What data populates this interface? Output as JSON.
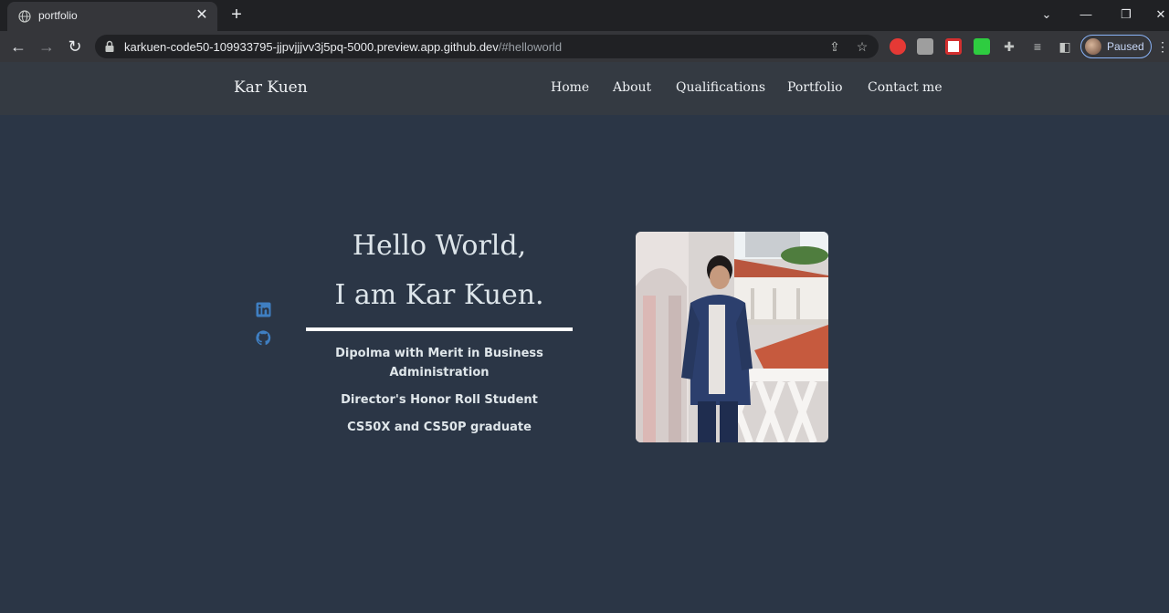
{
  "browser": {
    "tab_title": "portfolio",
    "url_host": "karkuen-code50-109933795-jjpvjjjvv3j5pq-5000.preview.app.github.dev",
    "url_path": "/#helloworld",
    "profile_label": "Paused"
  },
  "site": {
    "brand": "Kar Kuen",
    "nav": [
      "Home",
      "About",
      "Qualifications",
      "Portfolio",
      "Contact me"
    ]
  },
  "hero": {
    "title_line1": "Hello World,",
    "title_line2": "I am Kar Kuen.",
    "subtitle_1a": "Dipolma with Merit in Business",
    "subtitle_1b": "Administration",
    "subtitle_2": "Director's Honor Roll Student",
    "subtitle_3": "CS50X and CS50P graduate"
  },
  "social": {
    "icons": [
      "linkedin-icon",
      "github-icon"
    ],
    "accent_color": "#3f7fc2"
  },
  "colors": {
    "page_background": "#2b3646",
    "header_background": "#343a42"
  }
}
